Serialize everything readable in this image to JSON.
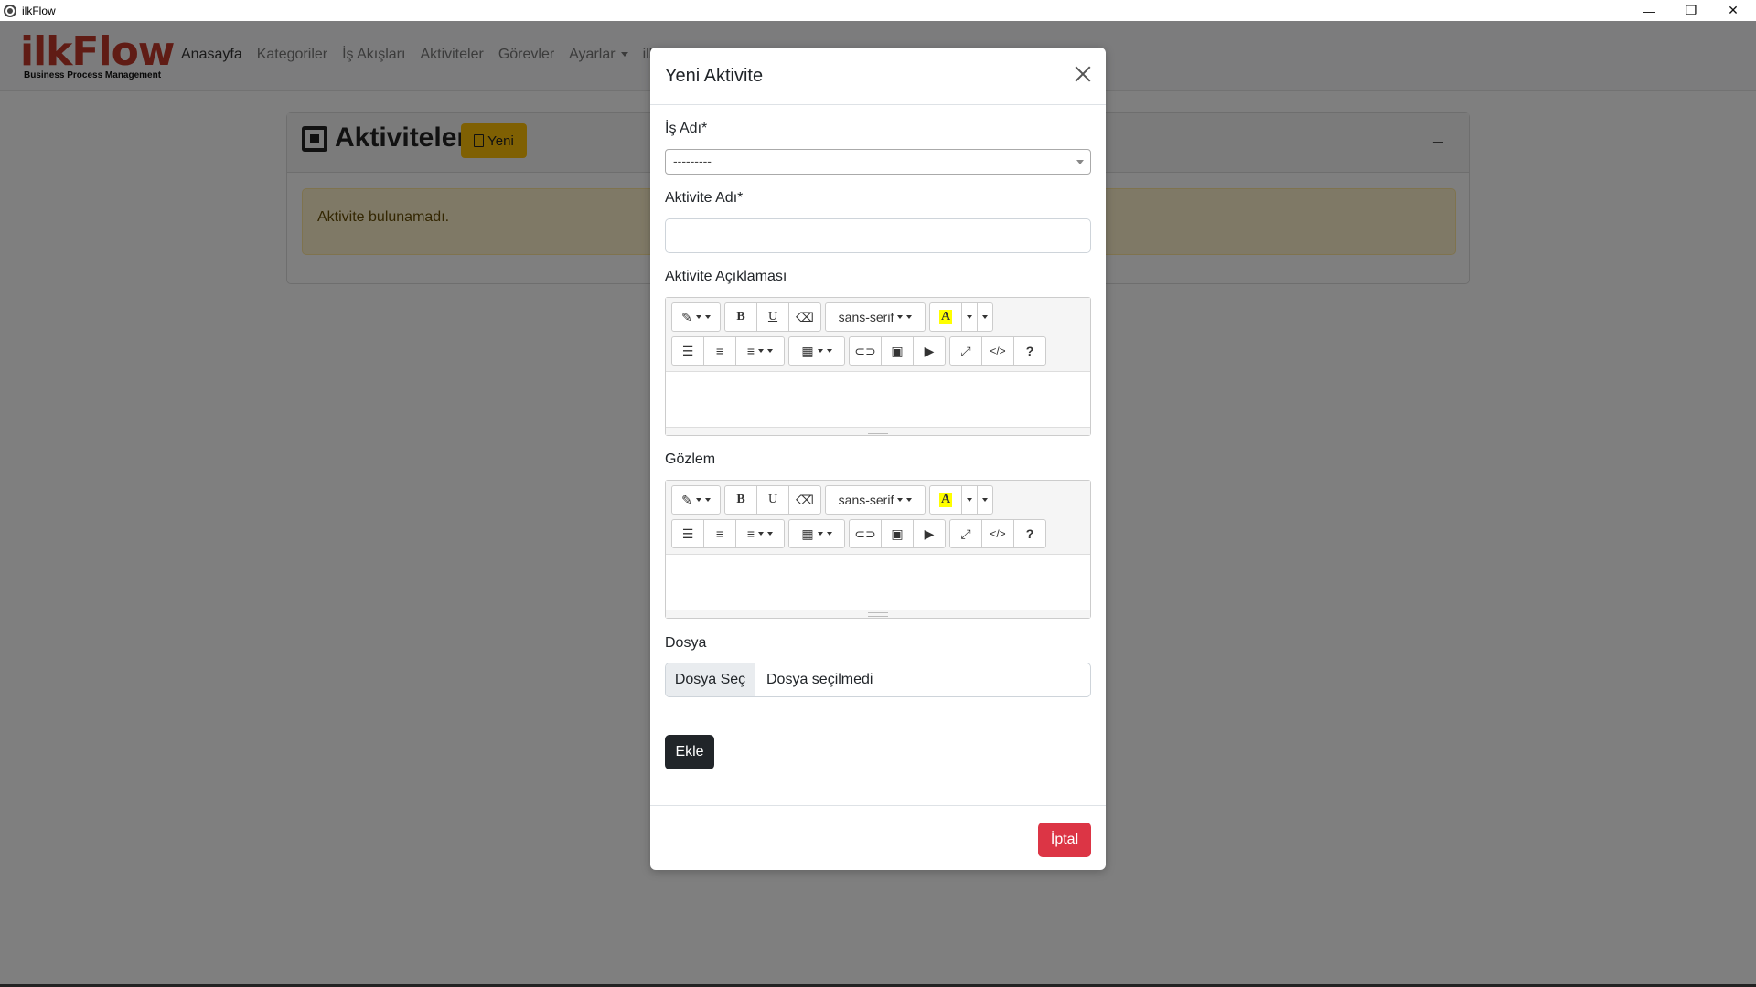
{
  "window": {
    "title": "ilkFlow",
    "controls": {
      "minimize": "—",
      "restore": "❐",
      "close": "✕"
    }
  },
  "navbar": {
    "brand": "ilkFlow",
    "brand_sub": "Business Process Management",
    "items": [
      {
        "label": "Anasayfa",
        "active": true
      },
      {
        "label": "Kategoriler"
      },
      {
        "label": "İş Akışları"
      },
      {
        "label": "Aktiviteler"
      },
      {
        "label": "Görevler"
      },
      {
        "label": "Ayarlar",
        "dropdown": true
      },
      {
        "label": "ilk"
      }
    ]
  },
  "page": {
    "title": "Aktiviteler",
    "new_button": "Yeni",
    "collapse": "–",
    "empty_message": "Aktivite bulunamadı."
  },
  "modal": {
    "title": "Yeni Aktivite",
    "fields": {
      "is_adi_label": "İş Adı*",
      "is_adi_value": "---------",
      "aktivite_adi_label": "Aktivite Adı*",
      "aktivite_adi_value": "",
      "aciklama_label": "Aktivite Açıklaması",
      "gozlem_label": "Gözlem",
      "dosya_label": "Dosya",
      "dosya_button": "Dosya Seç",
      "dosya_status": "Dosya seçilmedi"
    },
    "editor": {
      "font_name": "sans-serif",
      "bold": "B",
      "underline": "U",
      "color_letter": "A",
      "help": "?",
      "code": "</>"
    },
    "submit_label": "Ekle",
    "cancel_label": "İptal"
  },
  "colors": {
    "brand": "#c0392b",
    "warning": "#ffc107",
    "danger": "#dc3545",
    "dark": "#212529",
    "alert_bg": "#fff3cd"
  }
}
